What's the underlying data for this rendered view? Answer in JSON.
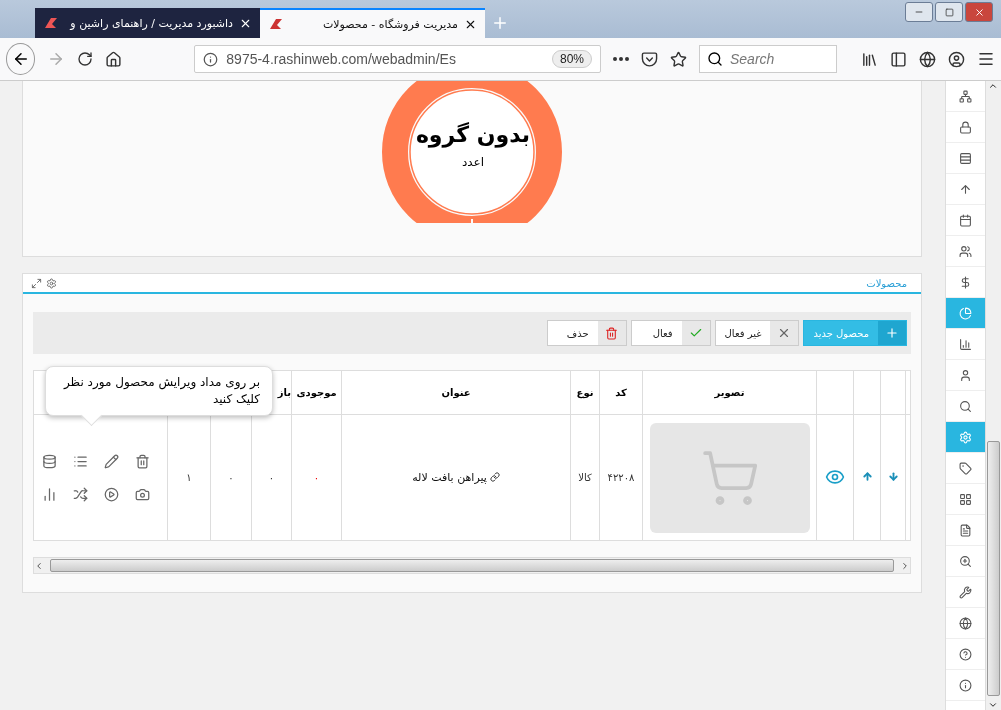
{
  "browser": {
    "tabs": [
      {
        "title": "مدیریت فروشگاه - محصولات",
        "selected": true
      },
      {
        "title": "داشبورد مدیریت / راهنمای راشین و",
        "selected": false
      }
    ],
    "url": "8975-4.rashinweb.com/webadmin/Es",
    "zoom": "80%",
    "search_placeholder": "Search"
  },
  "group_chart": {
    "title": "بدون گروه",
    "subtitle": "اعدد"
  },
  "products": {
    "title": "محصولات",
    "toolbar": [
      {
        "label": "محصول جدید",
        "kind": "add"
      },
      {
        "label": "غیر فعال",
        "kind": "deactivate"
      },
      {
        "label": "فعال",
        "kind": "activate"
      },
      {
        "label": "حذف",
        "kind": "delete"
      }
    ],
    "columns": {
      "image": "تصویر",
      "code": "کد",
      "type": "نوع",
      "title": "عنوان",
      "stock": "موجودی",
      "column_10": "باز"
    },
    "rows": [
      {
        "code": "۴۲۲۰۸",
        "type": "کالا",
        "title": "پیراهن بافت لاله",
        "stock": "۰",
        "column_10": "۰",
        "column_11": "۰",
        "column_12": "۱"
      }
    ],
    "tooltip": "بر روی مداد ویرایش محصول مورد نظر کلیک کنید"
  },
  "sidebar": {
    "items": [
      {
        "selected": false
      },
      {
        "selected": false
      },
      {
        "selected": false
      },
      {
        "selected": false
      },
      {
        "selected": false
      },
      {
        "selected": false
      },
      {
        "selected": false
      },
      {
        "selected": true
      },
      {
        "selected": false
      },
      {
        "selected": false
      },
      {
        "selected": false
      },
      {
        "selected": true
      },
      {
        "selected": false
      },
      {
        "selected": false
      },
      {
        "selected": false
      },
      {
        "selected": false
      },
      {
        "selected": false
      },
      {
        "selected": false
      },
      {
        "selected": false
      },
      {
        "selected": false
      }
    ]
  }
}
